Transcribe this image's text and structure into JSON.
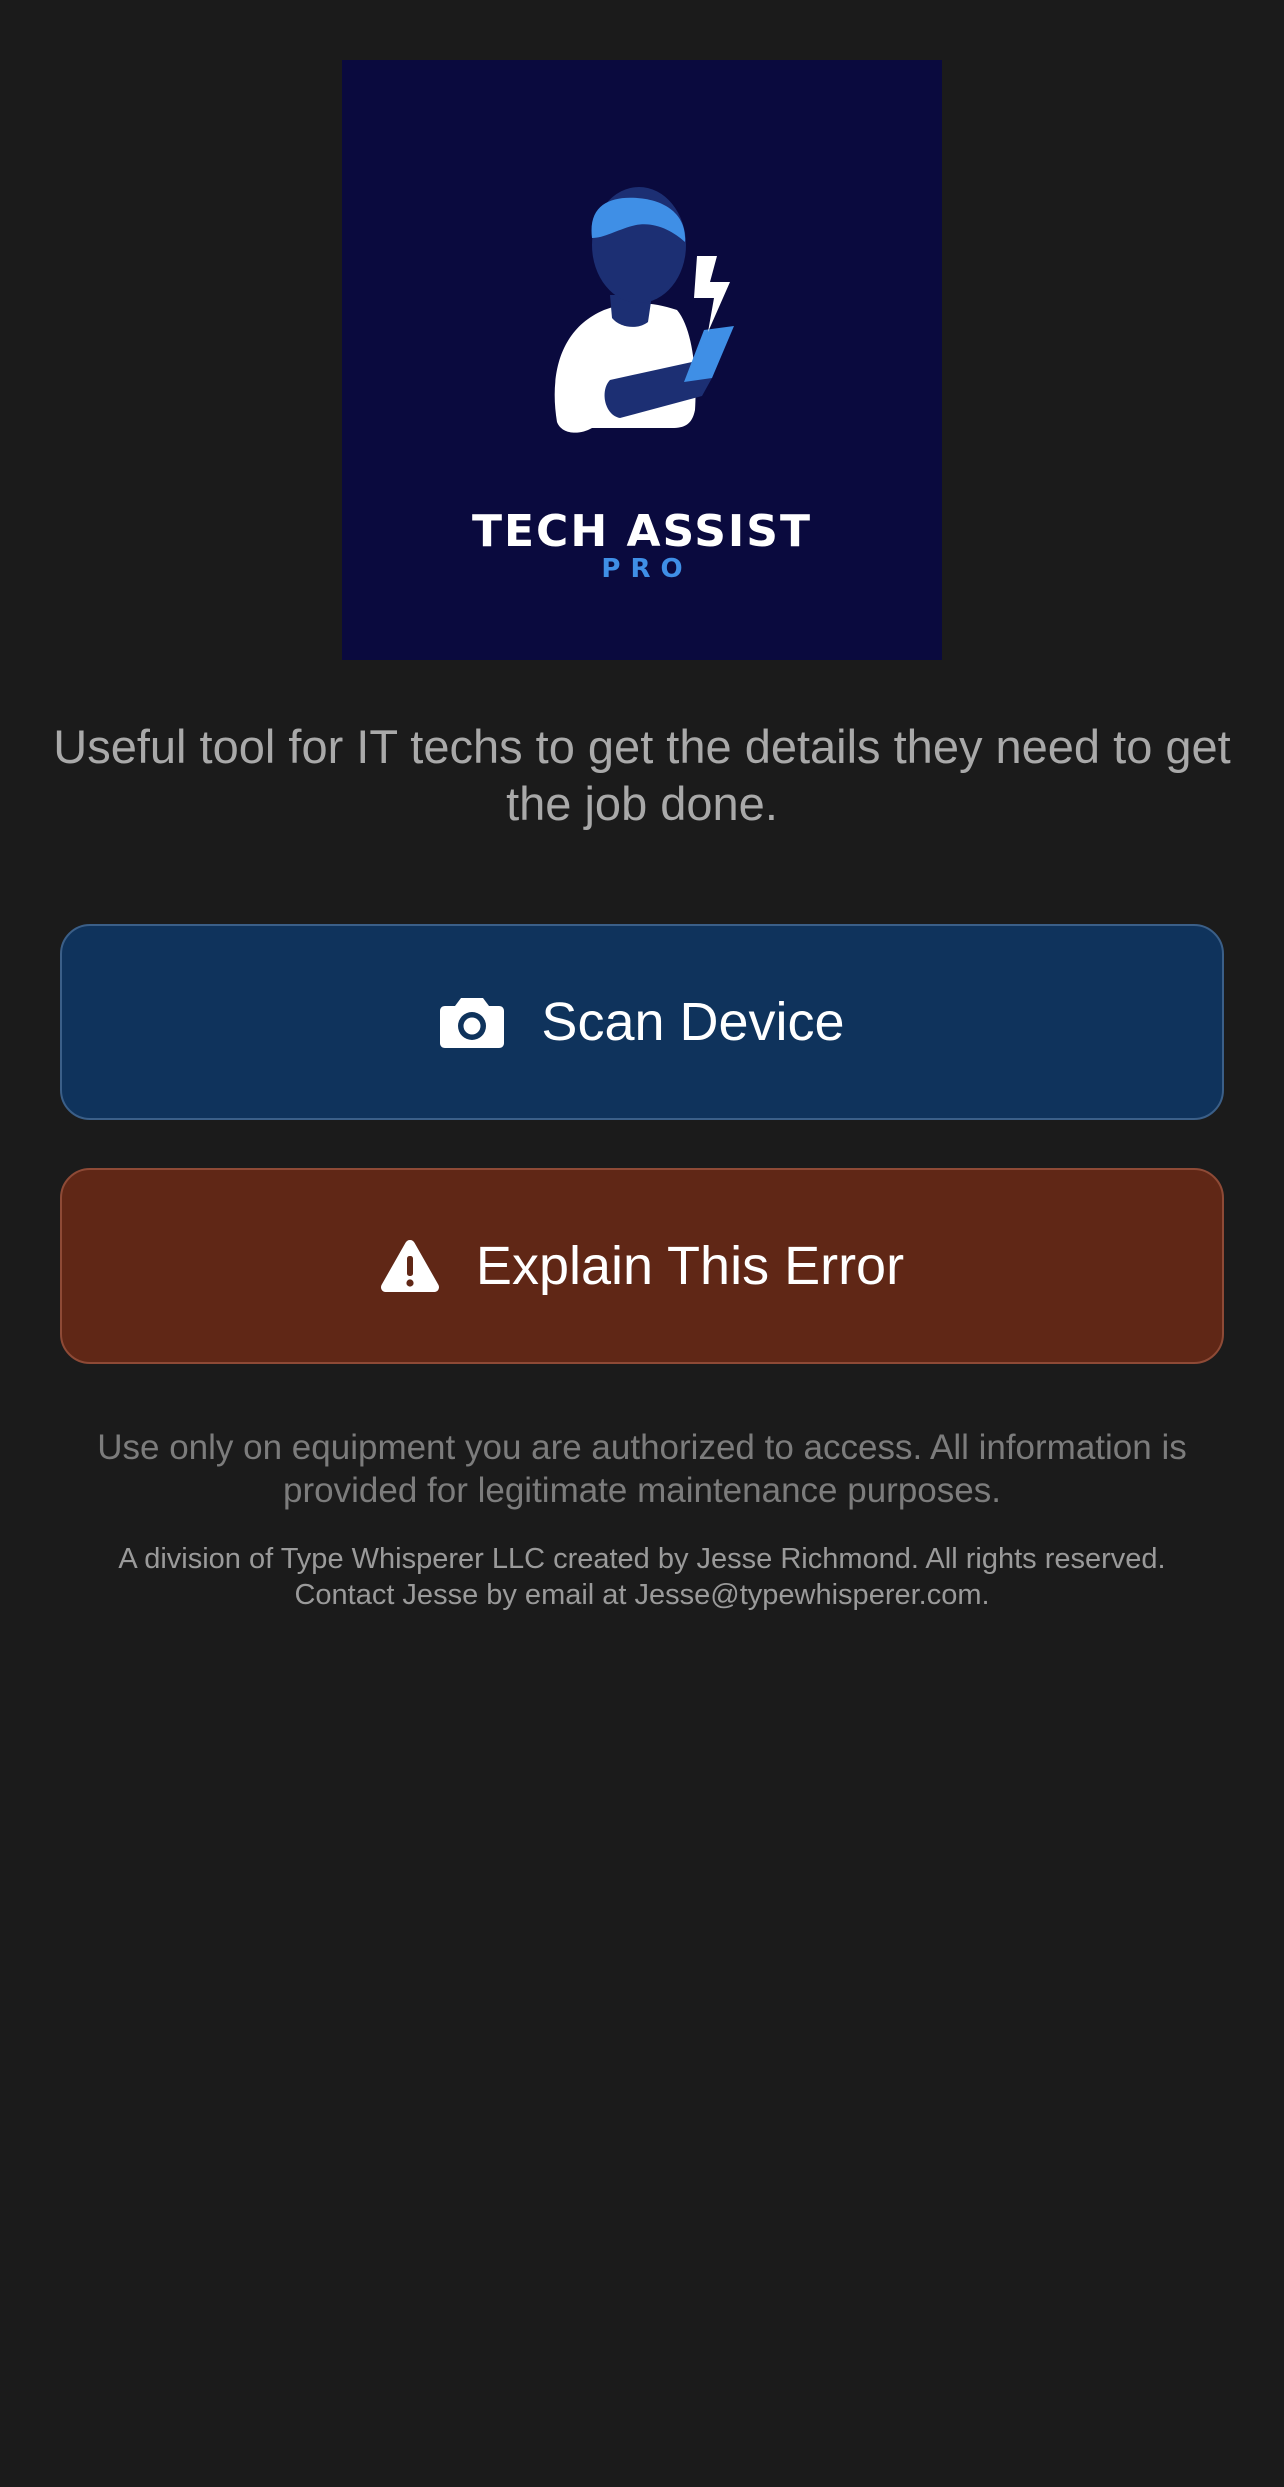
{
  "logo": {
    "icon": "technician-with-tablet-and-lightning-icon",
    "title": "TECH ASSIST",
    "subtitle": "PRO",
    "colors": {
      "background": "#0a0a3e",
      "accent": "#3f8fe6"
    }
  },
  "tagline": "Useful tool for IT techs to get the details they need to get the job done.",
  "actions": {
    "scan": {
      "label": "Scan Device",
      "icon": "camera-icon",
      "color": "#0f335c"
    },
    "explain": {
      "label": "Explain This Error",
      "icon": "warning-icon",
      "color": "#602716"
    }
  },
  "disclaimer": "Use only on equipment you are authorized to access. All information is provided for legitimate maintenance purposes.",
  "footer": "A division of Type Whisperer LLC created by Jesse Richmond. All rights reserved. Contact Jesse by email at Jesse@typewhisperer.com."
}
